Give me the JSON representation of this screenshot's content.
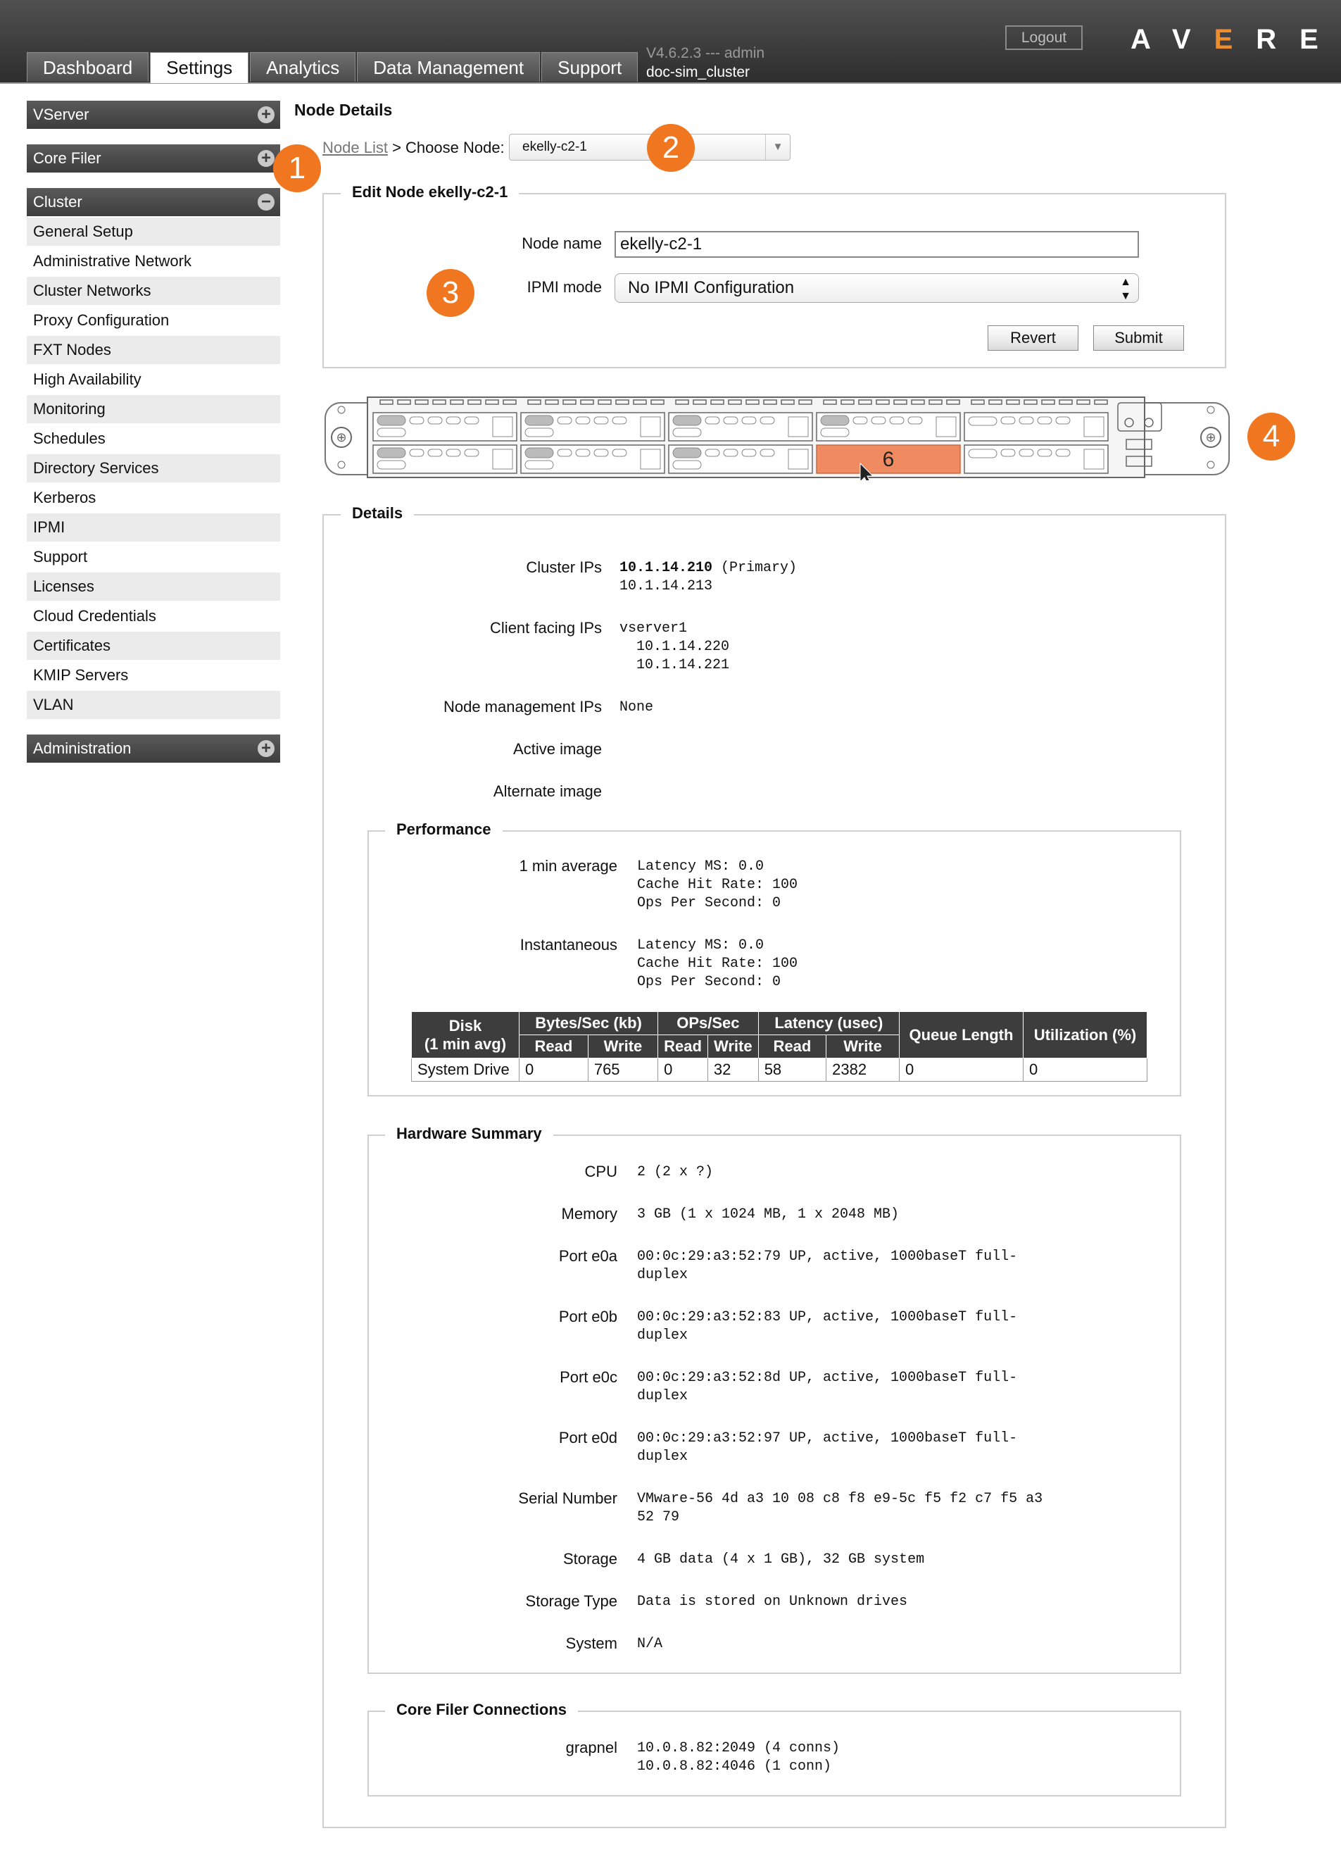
{
  "header": {
    "tabs": [
      "Dashboard",
      "Settings",
      "Analytics",
      "Data Management",
      "Support"
    ],
    "active_tab": "Settings",
    "version": "V4.6.2.3 --- admin",
    "cluster": "doc-sim_cluster",
    "logout": "Logout",
    "logo": "AVERE"
  },
  "sidebar": {
    "sections": [
      {
        "title": "VServer",
        "toggle": "+"
      },
      {
        "title": "Core Filer",
        "toggle": "+"
      },
      {
        "title": "Cluster",
        "toggle": "−"
      },
      {
        "title": "Administration",
        "toggle": "+"
      }
    ],
    "cluster_items": [
      "General Setup",
      "Administrative Network",
      "Cluster Networks",
      "Proxy Configuration",
      "FXT Nodes",
      "High Availability",
      "Monitoring",
      "Schedules",
      "Directory Services",
      "Kerberos",
      "IPMI",
      "Support",
      "Licenses",
      "Cloud Credentials",
      "Certificates",
      "KMIP Servers",
      "VLAN"
    ]
  },
  "main": {
    "title": "Node Details",
    "breadcrumb_link": "Node List",
    "breadcrumb_rest": " > Choose Node:",
    "node_select": "ekelly-c2-1",
    "edit": {
      "legend": "Edit Node ekelly-c2-1",
      "node_name_label": "Node name",
      "node_name_value": "ekelly-c2-1",
      "ipmi_label": "IPMI mode",
      "ipmi_value": "No IPMI Configuration",
      "revert": "Revert",
      "submit": "Submit"
    },
    "chassis": {
      "selected_drive": "6"
    },
    "details": {
      "legend": "Details",
      "cluster_ips_label": "Cluster IPs",
      "cluster_ip_primary": "10.1.14.210",
      "cluster_ip_primary_note": " (Primary)",
      "cluster_ip_2": "10.1.14.213",
      "client_ips_label": "Client facing IPs",
      "client_ips_value": "vserver1\n  10.1.14.220\n  10.1.14.221",
      "mgmt_ips_label": "Node management IPs",
      "mgmt_ips_value": "None",
      "active_image_label": "Active image",
      "alternate_image_label": "Alternate image"
    },
    "performance": {
      "legend": "Performance",
      "avg_label": "1 min average",
      "avg_value": "Latency MS: 0.0\nCache Hit Rate: 100\nOps Per Second: 0",
      "inst_label": "Instantaneous",
      "inst_value": "Latency MS: 0.0\nCache Hit Rate: 100\nOps Per Second: 0",
      "table": {
        "disk_header": "Disk\n(1 min avg)",
        "groups": [
          "Bytes/Sec (kb)",
          "OPs/Sec",
          "Latency (usec)"
        ],
        "sub": [
          "Read",
          "Write"
        ],
        "queue": "Queue Length",
        "util": "Utilization (%)",
        "row": [
          "System Drive",
          "0",
          "765",
          "0",
          "32",
          "58",
          "2382",
          "0",
          "0"
        ]
      }
    },
    "hardware": {
      "legend": "Hardware Summary",
      "rows": [
        {
          "label": "CPU",
          "value": "2 (2 x ?)"
        },
        {
          "label": "Memory",
          "value": "3 GB (1 x 1024 MB, 1 x 2048 MB)"
        },
        {
          "label": "Port e0a",
          "value": "00:0c:29:a3:52:79 UP, active, 1000baseT full-\nduplex"
        },
        {
          "label": "Port e0b",
          "value": "00:0c:29:a3:52:83 UP, active, 1000baseT full-\nduplex"
        },
        {
          "label": "Port e0c",
          "value": "00:0c:29:a3:52:8d UP, active, 1000baseT full-\nduplex"
        },
        {
          "label": "Port e0d",
          "value": "00:0c:29:a3:52:97 UP, active, 1000baseT full-\nduplex"
        },
        {
          "label": "Serial Number",
          "value": "VMware-56 4d a3 10 08 c8 f8 e9-5c f5 f2 c7 f5 a3\n52 79"
        },
        {
          "label": "Storage",
          "value": "4 GB data (4 x 1 GB), 32 GB system"
        },
        {
          "label": "Storage Type",
          "value": "Data is stored on Unknown drives"
        },
        {
          "label": "System",
          "value": "N/A"
        }
      ]
    },
    "corefiler": {
      "legend": "Core Filer Connections",
      "label": "grapnel",
      "value": "10.0.8.82:2049 (4 conns)\n10.0.8.82:4046 (1 conn)"
    }
  },
  "callouts": [
    "1",
    "2",
    "3",
    "4"
  ],
  "colors": {
    "accent": "#f0771f",
    "header": "#3d3d3d",
    "selected_drive": "#f08a60"
  }
}
